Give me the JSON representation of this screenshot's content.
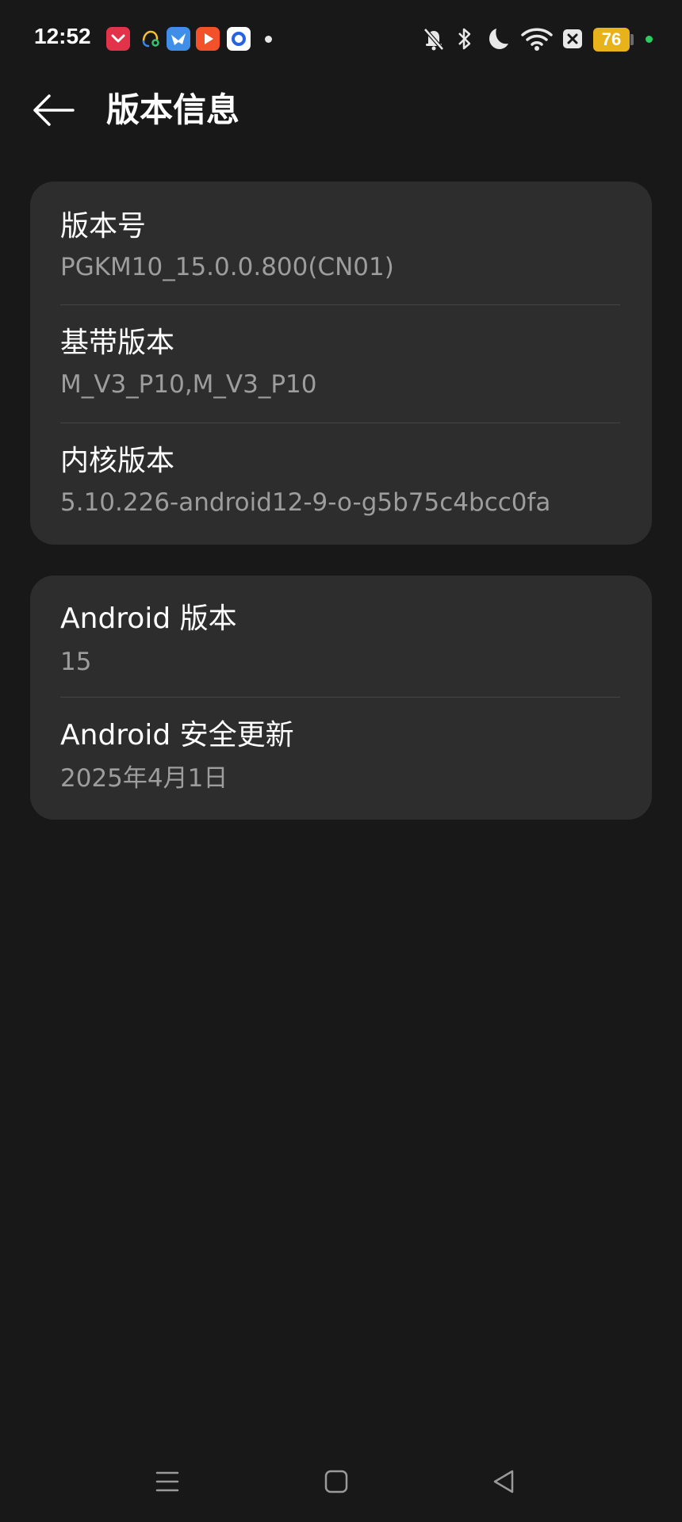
{
  "status_bar": {
    "time": "12:52",
    "battery_level": "76",
    "notification_icons": [
      "pocket-app-icon",
      "headset-app-icon",
      "bird-app-icon",
      "video-play-app-icon",
      "circle-app-icon"
    ],
    "system_icons": [
      "bell-muted-icon",
      "bluetooth-icon",
      "moon-icon",
      "wifi-icon",
      "box-x-icon"
    ],
    "colors": {
      "battery": "#e8b21a",
      "charging_dot": "#2dcc63",
      "pocket": "#e2334a",
      "bird": "#3f8fe8",
      "video": "#f2512a",
      "circle": "#2563e0"
    }
  },
  "header": {
    "title": "版本信息"
  },
  "groups": [
    {
      "items": [
        {
          "title": "版本号",
          "value": "PGKM10_15.0.0.800(CN01)"
        },
        {
          "title": "基带版本",
          "value": "M_V3_P10,M_V3_P10"
        },
        {
          "title": "内核版本",
          "value": "5.10.226-android12-9-o-g5b75c4bcc0fa"
        }
      ]
    },
    {
      "items": [
        {
          "title": "Android 版本",
          "value": "15"
        },
        {
          "title": "Android 安全更新",
          "value": "2025年4月1日"
        }
      ]
    }
  ],
  "nav_bar": {
    "buttons": [
      "menu-icon",
      "home-icon",
      "back-triangle-icon"
    ]
  },
  "theme": {
    "background": "#181818",
    "card": "#2d2d2d",
    "text_primary": "#ffffff",
    "text_secondary": "#9d9d9d",
    "divider": "#444444"
  }
}
